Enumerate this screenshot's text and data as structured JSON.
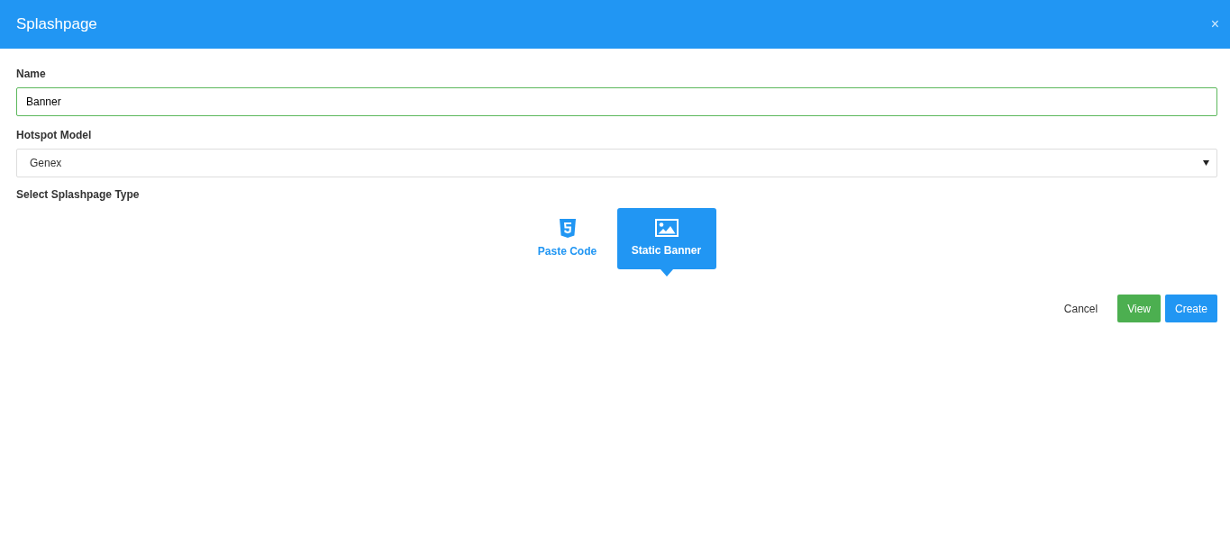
{
  "window": {
    "title": "Splashpage",
    "close": "×"
  },
  "name_field": {
    "label": "Name",
    "value": "Banner",
    "valid": true
  },
  "hotspot_model": {
    "label": "Hotspot Model",
    "value": "Genex"
  },
  "splashpage_type": {
    "label": "Select Splashpage Type",
    "options": [
      {
        "kind": "code",
        "label": "Paste Code",
        "selected": false
      },
      {
        "kind": "image",
        "label": "Static Banner",
        "selected": true
      }
    ]
  },
  "buttons": [
    {
      "kind": "link",
      "label": "Cancel"
    },
    {
      "kind": "success",
      "label": "View"
    },
    {
      "kind": "primary",
      "label": "Create"
    }
  ]
}
